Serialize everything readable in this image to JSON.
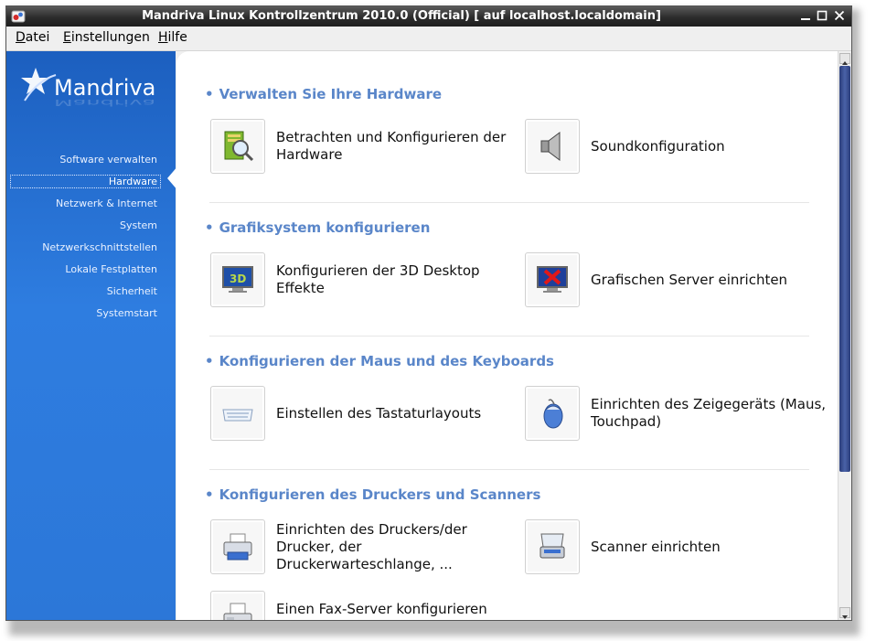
{
  "window": {
    "title": "Mandriva Linux Kontrollzentrum 2010.0 (Official) [ auf localhost.localdomain]",
    "buttons": [
      "minimize-icon",
      "maximize-icon",
      "close-icon"
    ]
  },
  "menubar": {
    "items": [
      {
        "label": "atei",
        "mnemonic": "D"
      },
      {
        "label": "instellungen",
        "mnemonic": "E"
      },
      {
        "label": "ilfe",
        "mnemonic": "H"
      }
    ]
  },
  "sidebar": {
    "logo": "Mandriva",
    "selected": "Hardware",
    "items": [
      {
        "label": "Software verwalten"
      },
      {
        "label": "Hardware"
      },
      {
        "label": "Netzwerk & Internet"
      },
      {
        "label": "System"
      },
      {
        "label": "Netzwerkschnittstellen"
      },
      {
        "label": "Lokale Festplatten"
      },
      {
        "label": "Sicherheit"
      },
      {
        "label": "Systemstart"
      }
    ]
  },
  "sections": [
    {
      "title": "Verwalten Sie Ihre Hardware",
      "tools": [
        {
          "label": "Betrachten und Konfigurieren der Hardware",
          "icon": "hardware-browser-icon"
        },
        {
          "label": "Soundkonfiguration",
          "icon": "speaker-icon"
        }
      ]
    },
    {
      "title": "Grafiksystem konfigurieren",
      "tools": [
        {
          "label": "Konfigurieren der 3D Desktop Effekte",
          "icon": "3d-monitor-icon"
        },
        {
          "label": "Grafischen Server einrichten",
          "icon": "x-server-monitor-icon"
        }
      ]
    },
    {
      "title": "Konfigurieren der Maus und des Keyboards",
      "tools": [
        {
          "label": "Einstellen des Tastaturlayouts",
          "icon": "keyboard-icon"
        },
        {
          "label": "Einrichten des Zeigegeräts (Maus, Touchpad)",
          "icon": "mouse-icon"
        }
      ]
    },
    {
      "title": "Konfigurieren des Druckers und Scanners",
      "tools": [
        {
          "label": "Einrichten des Druckers/der Drucker, der Druckerwarteschlange, ...",
          "icon": "printer-icon"
        },
        {
          "label": "Scanner einrichten",
          "icon": "scanner-icon"
        },
        {
          "label": "Einen Fax-Server konfigurieren",
          "icon": "fax-icon"
        }
      ]
    }
  ],
  "colors": {
    "sidebar": "#2c77d8",
    "section_title": "#5a86c9",
    "scroll_thumb": "#3b509a"
  }
}
